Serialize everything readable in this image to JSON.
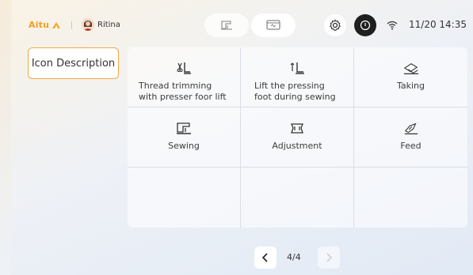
{
  "header": {
    "brand": "Aitu",
    "user_name": "Ritina",
    "datetime": "11/20 14:35",
    "mode_icons": [
      "sewing-machine-icon",
      "screen-icon"
    ],
    "settings_icon": "gear-icon",
    "power_icon": "power-icon",
    "wifi_icon": "wifi-icon"
  },
  "sidebar": {
    "items": [
      {
        "label": "Icon Description",
        "selected": true
      }
    ]
  },
  "icons_grid": {
    "items": [
      {
        "icon": "thread-trim-presser-lift-icon",
        "label": "Thread trimming with presser foor lift"
      },
      {
        "icon": "lift-presser-foot-icon",
        "label": "Lift the pressing foot during sewing"
      },
      {
        "icon": "taking-icon",
        "label": "Taking"
      },
      {
        "icon": "sewing-icon",
        "label": "Sewing"
      },
      {
        "icon": "adjustment-icon",
        "label": "Adjustment"
      },
      {
        "icon": "feed-icon",
        "label": "Feed"
      }
    ]
  },
  "pager": {
    "text": "4/4",
    "current": 4,
    "total": 4
  },
  "colors": {
    "accent": "#f0a848",
    "brand": "#f0a020"
  }
}
